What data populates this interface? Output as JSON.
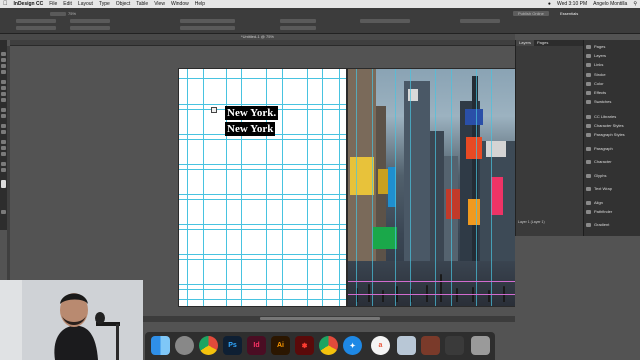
{
  "menubar": {
    "app_name": "InDesign CC",
    "items": [
      "File",
      "Edit",
      "Layout",
      "Type",
      "Object",
      "Table",
      "View",
      "Window",
      "Help"
    ],
    "clock": "Wed 3:10 PM",
    "user": "Angelo Montilla"
  },
  "control": {
    "zoom": "75%",
    "essentials": "Essentials",
    "publish_online": "Publish Online"
  },
  "document": {
    "tab_title": "*Untitled-1 @ 75%"
  },
  "page_left": {
    "headline_line1": "New York.",
    "headline_line2": "New York"
  },
  "layers_panel": {
    "tabs": [
      "Layers",
      "Pages"
    ],
    "layer_info": "Layer 1 (Layer 1)"
  },
  "right_panel": {
    "items": [
      "Pages",
      "Layers",
      "Links",
      "Stroke",
      "Color",
      "Effects",
      "Swatches",
      "CC Libraries",
      "Character Styles",
      "Paragraph Styles",
      "Paragraph",
      "Character",
      "Glyphs",
      "Text Wrap",
      "Align",
      "Pathfinder",
      "Gradient"
    ]
  },
  "dock": {
    "apps": [
      "Finder",
      "Launchpad",
      "Chrome",
      "Ps",
      "Id",
      "Ai",
      "Acrobat",
      "Chrome",
      "Safari",
      "Avocode",
      "Preview",
      "Trash"
    ]
  },
  "colors": {
    "guide": "#48c3e0",
    "margin": "#d16bcf",
    "accent_id": "#ff3366"
  }
}
